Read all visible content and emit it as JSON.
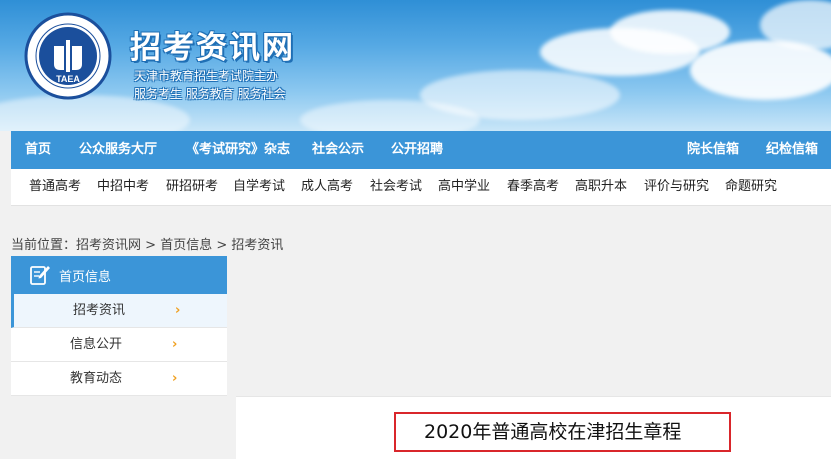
{
  "header": {
    "site_title": "招考资讯网",
    "logo_text": "TAEA",
    "slogan_1": "天津市教育招生考试院主办",
    "slogan_2": "服务考生 服务教育 服务社会"
  },
  "main_nav": {
    "items": [
      "首页",
      "公众服务大厅",
      "《考试研究》杂志",
      "社会公示",
      "公开招聘"
    ],
    "right_items": [
      "院长信箱",
      "纪检信箱"
    ]
  },
  "sub_nav": {
    "items": [
      "普通高考",
      "中招中考",
      "研招研考",
      "自学考试",
      "成人高考",
      "社会考试",
      "高中学业",
      "春季高考",
      "高职升本",
      "评价与研究",
      "命题研究"
    ]
  },
  "breadcrumb": {
    "prefix": "当前位置：",
    "items": [
      "招考资讯网",
      "首页信息",
      "招考资讯"
    ],
    "separator": " > "
  },
  "sidebar": {
    "title": "首页信息",
    "items": [
      "招考资讯",
      "信息公开",
      "教育动态"
    ],
    "active_index": 0,
    "chevron": "›"
  },
  "article": {
    "title": "2020年普通高校在津招生章程"
  },
  "colors": {
    "nav_blue": "#3b95d8",
    "accent_orange": "#f0a020",
    "title_border_red": "#d9262b"
  }
}
